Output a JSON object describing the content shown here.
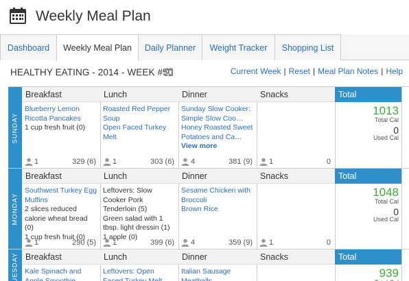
{
  "header": {
    "title": "Weekly Meal Plan"
  },
  "tabs": [
    {
      "label": "Dashboard",
      "active": false
    },
    {
      "label": "Weekly Meal Plan",
      "active": true
    },
    {
      "label": "Daily Planner",
      "active": false
    },
    {
      "label": "Weight Tracker",
      "active": false
    },
    {
      "label": "Shopping List",
      "active": false
    }
  ],
  "week": {
    "title": "HEALTHY EATING - 2014 - WEEK #50"
  },
  "links": {
    "current_week": "Current Week",
    "reset": "Reset",
    "notes": "Meal Plan Notes",
    "help": "Help",
    "sep": "|"
  },
  "colors": {
    "accent": "#2e8fcb",
    "link": "#2a6ebf",
    "total": "#3cad3c"
  },
  "columns": {
    "breakfast": "Breakfast",
    "lunch": "Lunch",
    "dinner": "Dinner",
    "snacks": "Snacks",
    "total": "Total"
  },
  "total_labels": {
    "total_cal": "Total Cal",
    "used_cal": "Used Cal"
  },
  "days": [
    {
      "name": "SUNDAY",
      "breakfast": {
        "items": [
          {
            "t": "Blueberry Lemon Ricotta Pancakes",
            "link": true
          },
          {
            "t": "1 cup fresh fruit (0)",
            "link": false
          }
        ],
        "people": "1",
        "cal": "329 (6)",
        "view_more": ""
      },
      "lunch": {
        "items": [
          {
            "t": "Roasted Red Pepper Soup",
            "link": true
          },
          {
            "t": "Open Faced Turkey Melt",
            "link": true
          }
        ],
        "people": "1",
        "cal": "303 (6)",
        "view_more": ""
      },
      "dinner": {
        "items": [
          {
            "t": "Sunday Slow Cooker: Simple Slow Coo…",
            "link": true
          },
          {
            "t": "Honey Roasted Sweet Potatoes and Ca…",
            "link": true
          }
        ],
        "people": "4",
        "cal": "381 (9)",
        "view_more": "View more"
      },
      "snacks": {
        "items": [],
        "people": "1",
        "cal": "0",
        "view_more": ""
      },
      "total": {
        "total_cal": "1013",
        "used_cal": "0"
      }
    },
    {
      "name": "MONDAY",
      "breakfast": {
        "items": [
          {
            "t": "Southwest Turkey Egg Muffins",
            "link": true
          },
          {
            "t": "2 slices reduced calorie wheat bread (0)",
            "link": false
          },
          {
            "t": "1 cup fresh fruit (0)",
            "link": false
          }
        ],
        "people": "1",
        "cal": "290 (5)",
        "view_more": ""
      },
      "lunch": {
        "items": [
          {
            "t": "Leftovers: Slow Cooker Pork Tenderloin (5)",
            "link": false
          },
          {
            "t": "Green salad with 1 tbsp. light dressin (1)",
            "link": false
          },
          {
            "t": "1 apple (0)",
            "link": false
          }
        ],
        "people": "1",
        "cal": "399 (6)",
        "view_more": ""
      },
      "dinner": {
        "items": [
          {
            "t": "Sesame Chicken with Broccoli",
            "link": true
          },
          {
            "t": "Brown Rice",
            "link": true
          }
        ],
        "people": "4",
        "cal": "359 (9)",
        "view_more": ""
      },
      "snacks": {
        "items": [],
        "people": "1",
        "cal": "0",
        "view_more": ""
      },
      "total": {
        "total_cal": "1048",
        "used_cal": "0"
      }
    },
    {
      "name": "TUESDAY",
      "breakfast": {
        "items": [
          {
            "t": "Kale Spinach and Apple Smoothie",
            "link": true
          }
        ],
        "people": "",
        "cal": "",
        "view_more": ""
      },
      "lunch": {
        "items": [
          {
            "t": "Leftovers: Open Faced Turkey Melt",
            "link": true
          }
        ],
        "people": "",
        "cal": "",
        "view_more": ""
      },
      "dinner": {
        "items": [
          {
            "t": "Italian Sausage Meatballs",
            "link": true
          }
        ],
        "people": "",
        "cal": "",
        "view_more": ""
      },
      "snacks": {
        "items": [],
        "people": "",
        "cal": "",
        "view_more": ""
      },
      "total": {
        "total_cal": "939",
        "used_cal": ""
      }
    }
  ]
}
